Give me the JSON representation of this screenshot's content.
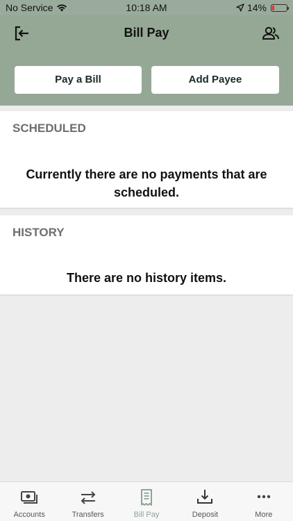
{
  "status_bar": {
    "carrier": "No Service",
    "time": "10:18 AM",
    "battery": "14%"
  },
  "header": {
    "title": "Bill Pay",
    "pay_bill_label": "Pay a Bill",
    "add_payee_label": "Add Payee"
  },
  "scheduled": {
    "heading": "SCHEDULED",
    "message": "Currently there are no payments that are scheduled."
  },
  "history": {
    "heading": "HISTORY",
    "message": "There are no history items."
  },
  "tabs": [
    {
      "label": "Accounts",
      "icon": "accounts-icon"
    },
    {
      "label": "Transfers",
      "icon": "transfers-icon"
    },
    {
      "label": "Bill Pay",
      "icon": "bill-pay-icon",
      "active": true
    },
    {
      "label": "Deposit",
      "icon": "deposit-icon"
    },
    {
      "label": "More",
      "icon": "more-icon"
    }
  ],
  "colors": {
    "header_bg": "#95a896",
    "active_tab": "#8fa393",
    "battery_low": "#e0322e"
  }
}
